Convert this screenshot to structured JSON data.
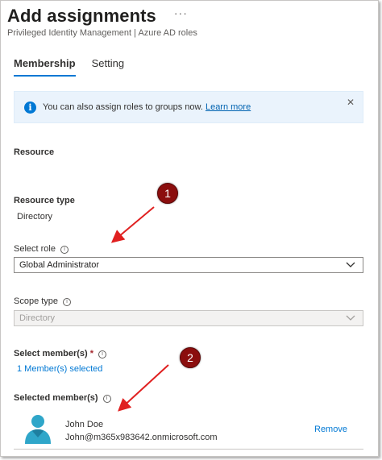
{
  "header": {
    "title": "Add assignments",
    "more_label": "···",
    "subtitle": "Privileged Identity Management | Azure AD roles"
  },
  "tabs": [
    {
      "label": "Membership",
      "active": true
    },
    {
      "label": "Setting",
      "active": false
    }
  ],
  "infobar": {
    "text": "You can also assign roles to groups now.",
    "link": "Learn more",
    "icon_glyph": "i",
    "close_glyph": "✕"
  },
  "form": {
    "resource_label": "Resource",
    "resource_type_label": "Resource type",
    "resource_type_value": "Directory",
    "select_role_label": "Select role",
    "select_role_value": "Global Administrator",
    "scope_type_label": "Scope type",
    "scope_type_value": "Directory",
    "select_members_label": "Select member(s)",
    "required_mark": "*",
    "members_selected_link": "1 Member(s) selected",
    "selected_members_label": "Selected member(s)",
    "help_glyph": "i"
  },
  "members": [
    {
      "name": "John Doe",
      "email": "John@m365x983642.onmicrosoft.com",
      "remove_label": "Remove"
    }
  ],
  "annotations": [
    {
      "number": "1"
    },
    {
      "number": "2"
    }
  ],
  "colors": {
    "accent": "#0078d4",
    "badge": "#8b0e0e",
    "arrow": "#e02020",
    "avatar": "#2fa6c9"
  }
}
